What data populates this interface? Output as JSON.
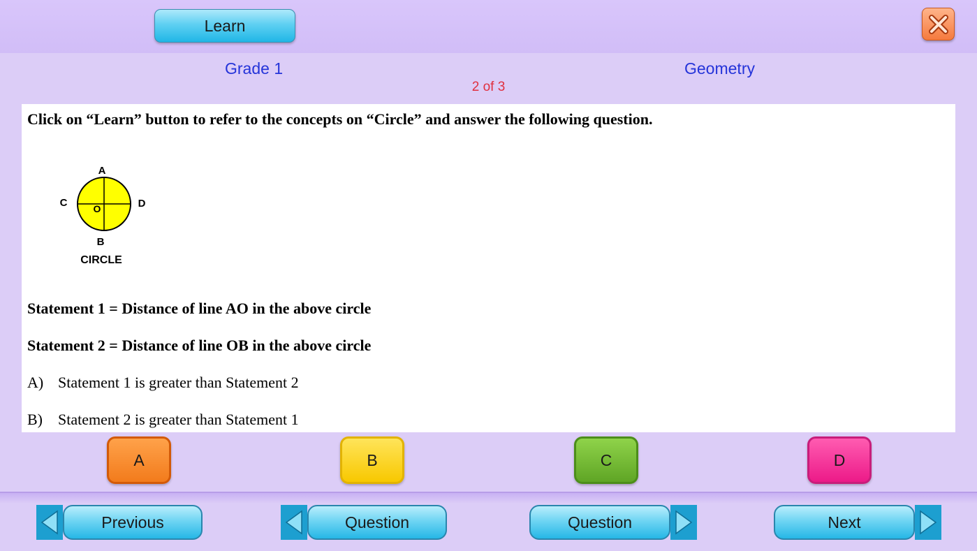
{
  "header": {
    "learn_label": "Learn",
    "close_icon": "close-x-icon"
  },
  "info": {
    "grade": "Grade 1",
    "subject": "Geometry",
    "progress": "2 of 3"
  },
  "question": {
    "instruction": "Click on “Learn” button to refer to the concepts on “Circle” and answer the following question.",
    "figure": {
      "labels": {
        "top": "A",
        "left": "C",
        "center": "O",
        "right": "D",
        "bottom": "B",
        "caption": "CIRCLE"
      },
      "fill_color": "#ffff00"
    },
    "statement1": "Statement 1 = Distance of line AO in the above circle",
    "statement2": "Statement 2 = Distance of line OB in the above circle",
    "options": [
      {
        "letter": "A)",
        "text": "Statement  1 is greater than Statement 2"
      },
      {
        "letter": "B)",
        "text": "Statement  2 is greater than Statement 1"
      }
    ]
  },
  "answers": {
    "a": "A",
    "b": "B",
    "c": "C",
    "d": "D",
    "colors": {
      "a": "#f27b1c",
      "b": "#f8c800",
      "c": "#5fa525",
      "d": "#ec1a88"
    }
  },
  "nav": {
    "previous": "Previous",
    "question_prev": "Question",
    "question_next": "Question",
    "next": "Next",
    "accent": "#1d9fd0"
  }
}
